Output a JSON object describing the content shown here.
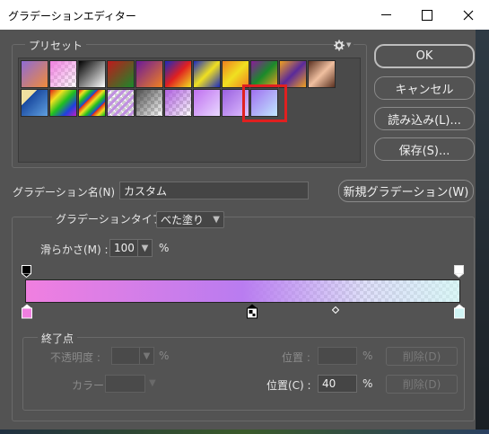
{
  "window": {
    "title": "グラデーションエディター"
  },
  "presets": {
    "label": "プリセット",
    "swatches": [
      {
        "bg": "linear-gradient(135deg,#8e6bd6,#f08b3a)",
        "checker": false
      },
      {
        "bg": "linear-gradient(135deg,#f080e0,rgba(255,255,255,0.1))",
        "checker": true
      },
      {
        "bg": "linear-gradient(135deg,#000,#fff)",
        "checker": false
      },
      {
        "bg": "linear-gradient(135deg,#c0181c,#1a8a2a)",
        "checker": false
      },
      {
        "bg": "linear-gradient(135deg,#6a1a9a,#f08020)",
        "checker": false
      },
      {
        "bg": "linear-gradient(135deg,#1a2ac0,#e02020,#f0e020)",
        "checker": false
      },
      {
        "bg": "linear-gradient(135deg,#1a2ac0,#f0e020,#1a2ac0)",
        "checker": false
      },
      {
        "bg": "linear-gradient(135deg,#f08020,#f0e020,#f08020)",
        "checker": false
      },
      {
        "bg": "linear-gradient(135deg,#8a1a9a,#1a8a2a,#f0a020)",
        "checker": false
      },
      {
        "bg": "linear-gradient(135deg,#f0a020,#5a2a9a,#f0a020)",
        "checker": false
      },
      {
        "bg": "linear-gradient(135deg,#5a3020,#f0c0a0,#5a3020)",
        "checker": false
      },
      {
        "bg": "linear-gradient(135deg,#f0e0a0 30%,#1a4aa0 30%,#60a0e0)",
        "checker": false
      },
      {
        "bg": "linear-gradient(135deg,#e0201a,#f0e020,#20c020,#2040e0,#c020c0)",
        "checker": false
      },
      {
        "bg": "repeating-linear-gradient(135deg,#e0201a 0,#f0e020 5px,#20c020 10px,#2040e0 15px)",
        "checker": false
      },
      {
        "bg": "repeating-linear-gradient(135deg,#c090e0 0,#c090e0 3px,rgba(255,255,255,0) 3px,rgba(255,255,255,0) 6px)",
        "checker": true
      },
      {
        "bg": "linear-gradient(135deg,#505050,rgba(255,255,255,0))",
        "checker": true
      },
      {
        "bg": "linear-gradient(135deg,#b060e0,rgba(255,255,255,0))",
        "checker": true
      },
      {
        "bg": "linear-gradient(135deg,#c070f0,#e8d8ff)",
        "checker": true
      },
      {
        "bg": "linear-gradient(135deg,#9a60e0,#e0c0ff)",
        "checker": true
      },
      {
        "bg": "linear-gradient(135deg,#a070f0,#c0e8ff)",
        "checker": true
      }
    ],
    "selected_index": 19
  },
  "buttons": {
    "ok": "OK",
    "cancel": "キャンセル",
    "load": "読み込み(L)...",
    "save": "保存(S)...",
    "new_gradient": "新規グラデーション(W)"
  },
  "name_field": {
    "label": "グラデーション名(N) :",
    "value": "カスタム"
  },
  "gradient_type": {
    "label": "グラデーションタイプ :",
    "value": "べた塗り"
  },
  "smoothness": {
    "label": "滑らかさ(M) :",
    "value": "100",
    "unit": "%"
  },
  "gradient_bar": {
    "colors": [
      "#f07fe0",
      "#b97cf0",
      "#c8c8f5",
      "#d0f4f4"
    ],
    "midpoint_percent": 70,
    "color_stop_percent": [
      0,
      50,
      100
    ],
    "opacity_stop_percent": [
      0,
      100
    ]
  },
  "stops": {
    "label": "終了点",
    "opacity_label": "不透明度 :",
    "opacity_unit": "%",
    "location_label_top": "位置 :",
    "location_unit_top": "%",
    "delete_top": "削除(D)",
    "color_label": "カラー :",
    "location_label": "位置(C) :",
    "location_value": "40",
    "location_unit": "%",
    "delete_bottom": "削除(D)"
  },
  "colors": {
    "accent_selection": "#e02020",
    "dialog_bg": "#535353"
  }
}
